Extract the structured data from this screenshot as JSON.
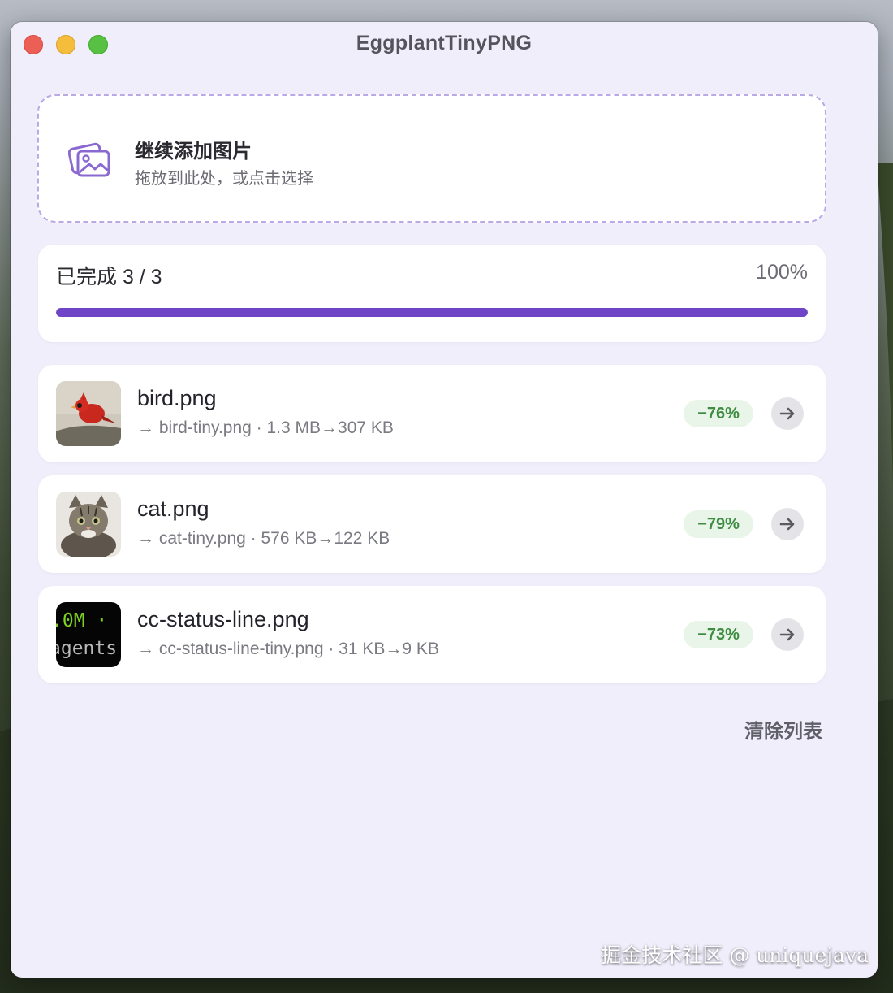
{
  "window": {
    "title": "EggplantTinyPNG"
  },
  "dropzone": {
    "icon": "images-icon",
    "title": "继续添加图片",
    "subtitle": "拖放到此处，或点击选择"
  },
  "progress": {
    "label": "已完成 3 / 3",
    "percent_text": "100%",
    "fraction": 1.0
  },
  "files": [
    {
      "name": "bird.png",
      "meta": "→ bird-tiny.png · 1.3 MB→307 KB",
      "reduction": "−76%",
      "thumb": "cardinal-bird-photo"
    },
    {
      "name": "cat.png",
      "meta": "→ cat-tiny.png · 576 KB→122 KB",
      "reduction": "−79%",
      "thumb": "kitten-photo"
    },
    {
      "name": "cc-status-line.png",
      "meta": "→ cc-status-line-tiny.png · 31 KB→9 KB",
      "reduction": "−73%",
      "thumb": "terminal-screenshot",
      "thumb_text_1": ".0M ·",
      "thumb_text_2": "agents"
    }
  ],
  "actions": {
    "clear_label": "清除列表"
  },
  "watermark": "掘金技术社区 @ uniquejava",
  "colors": {
    "accent": "#6f45c8",
    "success": "#3e8c42",
    "window_bg": "#f1eefb"
  }
}
